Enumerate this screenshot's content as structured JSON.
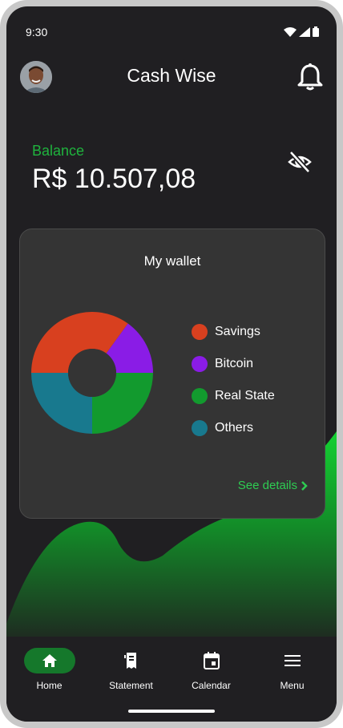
{
  "status_bar": {
    "time": "9:30",
    "icons": [
      "wifi-icon",
      "signal-icon",
      "battery-icon"
    ]
  },
  "header": {
    "title": "Cash Wise",
    "avatar": "avatar",
    "notification_icon": "bell-icon"
  },
  "balance": {
    "label": "Balance",
    "value": "R$ 10.507,08",
    "toggle_icon": "eye-off-icon"
  },
  "wallet": {
    "title": "My wallet",
    "see_details_label": "See details",
    "legend": [
      {
        "label": "Savings",
        "color": "#d8401f"
      },
      {
        "label": "Bitcoin",
        "color": "#8a1ce6"
      },
      {
        "label": "Real State",
        "color": "#129a2e"
      },
      {
        "label": "Others",
        "color": "#18798e"
      }
    ]
  },
  "chart_data": {
    "type": "pie",
    "categories": [
      "Savings",
      "Bitcoin",
      "Real State",
      "Others"
    ],
    "values": [
      35,
      15,
      25,
      25
    ],
    "colors": [
      "#d8401f",
      "#8a1ce6",
      "#129a2e",
      "#18798e"
    ],
    "donut": true
  },
  "bottom_nav": {
    "items": [
      {
        "label": "Home",
        "icon": "home-icon",
        "active": true
      },
      {
        "label": "Statement",
        "icon": "statement-icon",
        "active": false
      },
      {
        "label": "Calendar",
        "icon": "calendar-icon",
        "active": false
      },
      {
        "label": "Menu",
        "icon": "menu-icon",
        "active": false
      }
    ]
  },
  "colors": {
    "background": "#201f22",
    "card": "#343434",
    "accent_green": "#1fb33e",
    "active_nav": "#15782b"
  }
}
